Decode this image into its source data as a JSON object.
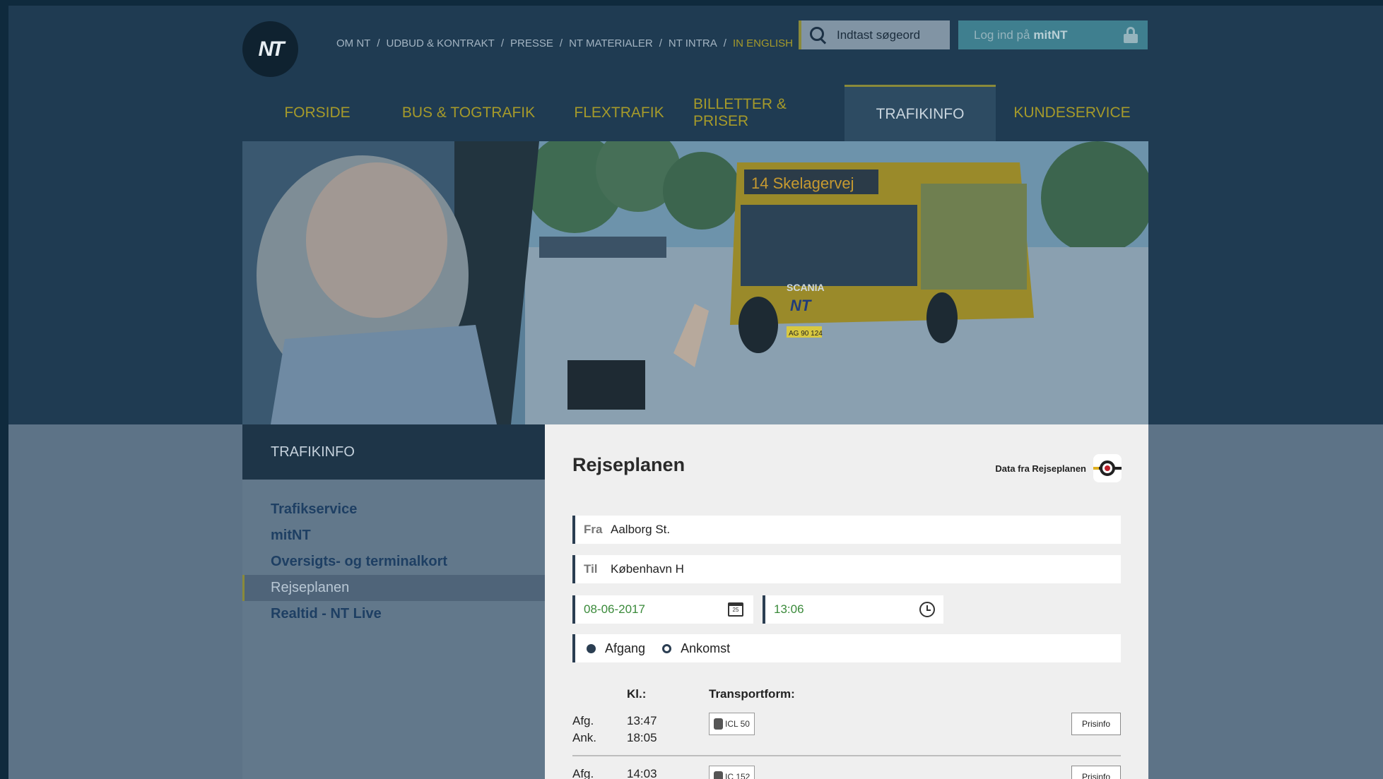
{
  "header": {
    "logo_text": "NT",
    "top_links": [
      "OM NT",
      "UDBUD & KONTRAKT",
      "PRESSE",
      "NT MATERIALER",
      "NT INTRA"
    ],
    "english_link": "IN ENGLISH",
    "search_placeholder": "Indtast søgeord",
    "login_prefix": "Log ind på",
    "login_brand": "mitNT"
  },
  "main_nav": [
    "FORSIDE",
    "BUS & TOGTRAFIK",
    "FLEXTRAFIK",
    "BILLETTER & PRISER",
    "TRAFIKINFO",
    "KUNDESERVICE"
  ],
  "main_nav_active": "TRAFIKINFO",
  "hero": {
    "bus_sign": "14 Skelagervej",
    "bus_brand": "SCANIA",
    "bus_logo": "NT",
    "plate": "AG 90 124"
  },
  "sidebar": {
    "title": "TRAFIKINFO",
    "items": [
      "Trafikservice",
      "mitNT",
      "Oversigts- og terminalkort",
      "Rejseplanen",
      "Realtid - NT Live"
    ],
    "active": "Rejseplanen"
  },
  "planner": {
    "title": "Rejseplanen",
    "credit": "Data fra Rejseplanen",
    "from_label": "Fra",
    "from_value": "Aalborg St.",
    "to_label": "Til",
    "to_value": "København H",
    "date": "08-06-2017",
    "calendar_day": "25",
    "time": "13:06",
    "radio_departure": "Afgang",
    "radio_arrival": "Ankomst",
    "selected_mode": "Afgang",
    "col_time": "Kl.:",
    "col_transport": "Transportform:",
    "results": [
      {
        "dep_label": "Afg.",
        "dep_time": "13:47",
        "arr_label": "Ank.",
        "arr_time": "18:05",
        "train": "ICL 50",
        "price_button": "Prisinfo"
      },
      {
        "dep_label": "Afg.",
        "dep_time": "14:03",
        "train": "IC 152",
        "price_button": "Prisinfo"
      }
    ]
  },
  "colors": {
    "overlay_dark": "#1f3b52",
    "accent_gold": "#a69a2a",
    "login_teal": "#3f7f8f",
    "date_green": "#3a8a3a"
  }
}
